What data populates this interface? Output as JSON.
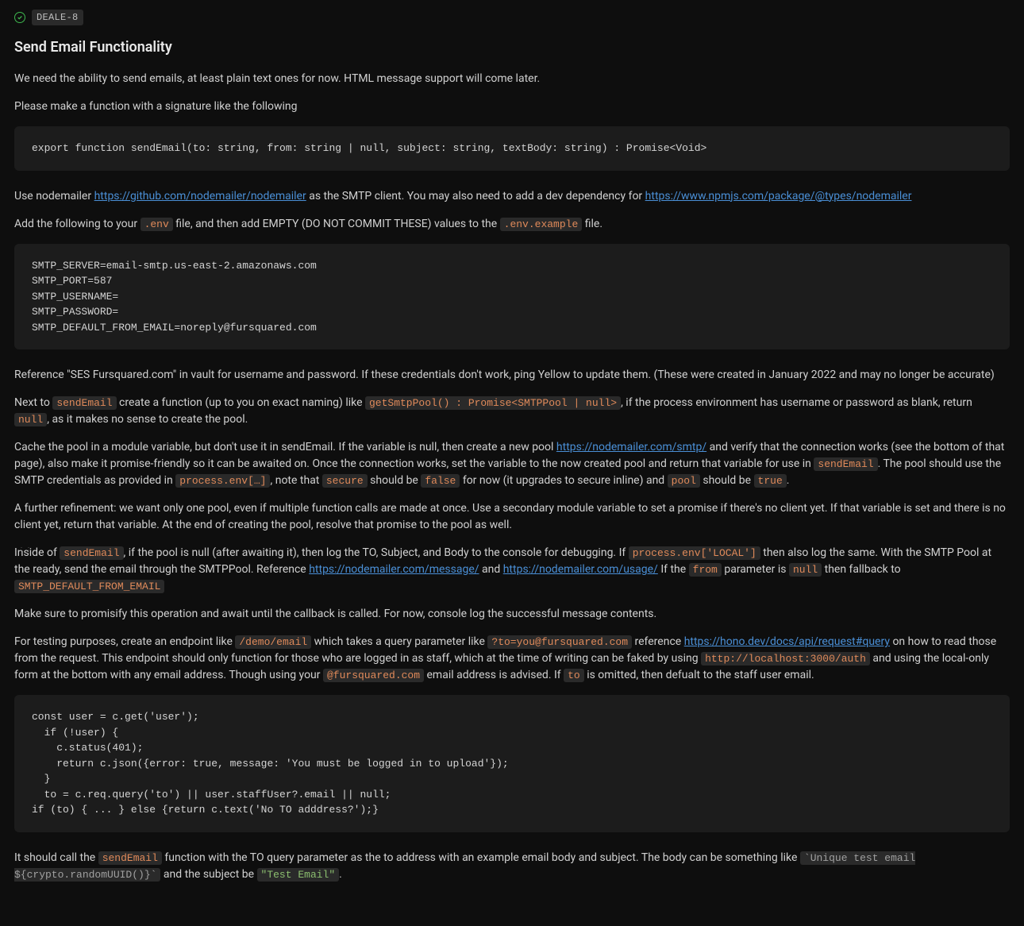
{
  "header": {
    "issue_key": "DEALE-8",
    "title": "Send Email Functionality"
  },
  "body": {
    "p1": "We need the ability to send emails, at least plain text ones for now. HTML message support will come later.",
    "p2": "Please make a function with a signature like the following",
    "code1": "export function sendEmail(to: string, from: string | null, subject: string, textBody: string) : Promise<Void>",
    "p3a": "Use nodemailer ",
    "link1": "https://github.com/nodemailer/nodemailer",
    "p3b": " as the SMTP client. You may also need to add a dev dependency for ",
    "link2": "https://www.npmjs.com/package/@types/nodemailer",
    "p4a": "Add the following to your ",
    "env": ".env",
    "p4b": " file, and then add EMPTY (DO NOT COMMIT THESE) values to the ",
    "envex": ".env.example",
    "p4c": " file.",
    "code2": "SMTP_SERVER=email-smtp.us-east-2.amazonaws.com\nSMTP_PORT=587\nSMTP_USERNAME=\nSMTP_PASSWORD=\nSMTP_DEFAULT_FROM_EMAIL=noreply@fursquared.com",
    "p5": "Reference \"SES Fursquared.com\" in vault for username and password. If these credentials don't work, ping Yellow to update them. (These were created in January 2022 and may no longer be accurate)",
    "p6a": "Next to ",
    "sendEmail": "sendEmail",
    "p6b": " create a function (up to you on exact naming) like ",
    "getSmtp": "getSmtpPool() : Promise<SMTPPool  | null>",
    "p6c": ", if the process environment has username or password as blank, return ",
    "null": "null",
    "p6d": ", as it makes no sense to create the pool.",
    "p7a": "Cache the pool in a module variable, but don't use it in sendEmail. If the variable is null, then create a new pool ",
    "link3": "https://nodemailer.com/smtp/",
    "p7b": " and verify that the connection works (see the bottom of that page), also make it promise-friendly so it can be awaited on. Once the connection works, set the variable to the now created pool and return that variable for use in ",
    "p7c": ". The pool should use the SMTP credentials as provided in ",
    "procenv": "process.env[…]",
    "p7d": ", note that ",
    "secure": "secure",
    "p7e": " should be ",
    "false": "false",
    "p7f": " for now (it upgrades to secure inline) and ",
    "pool": "pool",
    "p7g": " should be ",
    "true": "true",
    "p7h": ".",
    "p8": "A further refinement: we want only one pool, even if multiple function calls are made at once. Use a secondary module variable to set a promise if there's no client yet. If that variable is set and there is no client yet, return that variable. At the end of creating the pool, resolve that promise to the pool as well.",
    "p9a": "Inside of ",
    "p9b": ", if the pool is null (after awaiting it), then log the TO, Subject, and Body to the console for debugging. If ",
    "procenvLocal": "process.env['LOCAL']",
    "p9c": " then also log the same. With the SMTP Pool at the ready, send the email through the SMTPPool. Reference ",
    "link4": "https://nodemailer.com/message/",
    "p9d": " and ",
    "link5": "https://nodemailer.com/usage/",
    "p9e": " If the ",
    "from": "from",
    "p9f": " parameter is ",
    "p9g": " then fallback to ",
    "smtpDefault": "SMTP_DEFAULT_FROM_EMAIL",
    "p10": "Make sure to promisify this operation and await until the callback is called. For now, console log the successful message contents.",
    "p11a": "For testing purposes, create an endpoint like ",
    "demoEmail": "/demo/email",
    "p11b": " which takes a query parameter like ",
    "toQuery": "?to=you@fursquared.com",
    "p11c": " reference ",
    "link6": "https://hono.dev/docs/api/request#query",
    "p11d": " on how to read those from the request. This endpoint should only function for those who are logged in as staff, which at the time of writing can be faked by using ",
    "localhostAuth": "http://localhost:3000/auth",
    "p11e": " and using the local-only form at the bottom with any email address. Though using your ",
    "atFursquared": "@fursquared.com",
    "p11f": " email address is advised. If ",
    "to": "to",
    "p11g": " is omitted, then defualt to the staff user email.",
    "code3": "const user = c.get('user');\n  if (!user) {\n    c.status(401);\n    return c.json({error: true, message: 'You must be logged in to upload'});\n  }\n  to = c.req.query('to') || user.staffUser?.email || null;\nif (to) { ... } else {return c.text('No TO adddress?');}",
    "p12a": "It should call the ",
    "p12b": " function with the TO query parameter as the to address with an example email body and subject. The body can be something like ",
    "uniqueTest": "`Unique test email ${crypto.randomUUID()}`",
    "p12c": " and the subject be ",
    "testEmail": "\"Test Email\"",
    "p12d": "."
  }
}
